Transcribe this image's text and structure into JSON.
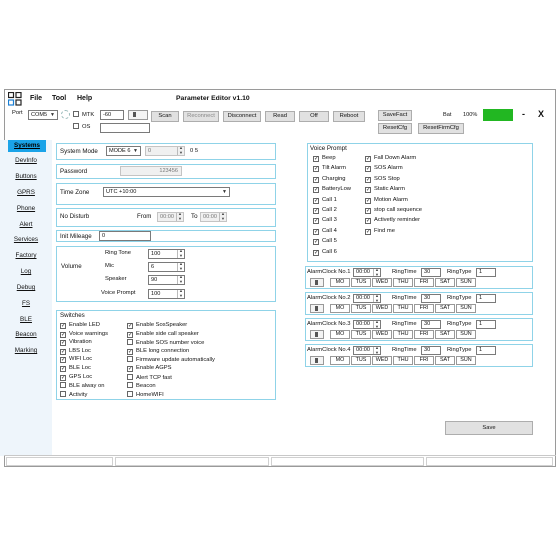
{
  "app": {
    "title": "Parameter Editor v1.10",
    "menu": [
      "File",
      "Tool",
      "Help"
    ],
    "close_label": "X",
    "minimize_label": "-"
  },
  "toolbar": {
    "port_label": "Port",
    "port_value": "COM5",
    "mtk_label": "MTK",
    "os_label": "OS",
    "level_value": "-60",
    "scan": "Scan",
    "reconnect": "Reconnect",
    "disconnect": "Disconnect",
    "read": "Read",
    "off": "Off",
    "reboot": "Reboot",
    "savefact": "SaveFact",
    "resetcfg": "ResetCfg",
    "resetfirmcfg": "ResetFirmCfg",
    "bat_label": "Bat",
    "bat_value": "100%",
    "bat_color": "#22b722"
  },
  "sidebar": {
    "items": [
      "Systems",
      "DevInfo",
      "Buttons",
      "GPRS",
      "Phone",
      "Alert",
      "Services",
      "Factory",
      "Log",
      "Debug",
      "FS",
      "BLE",
      "Beacon",
      "Marking"
    ],
    "active": "Systems",
    "active_color": "#1aa3e8"
  },
  "system": {
    "mode_label": "System Mode",
    "mode_value": "MODE 6",
    "mode_num": "0",
    "mode_extra": "0 5",
    "password_label": "Password",
    "password_value": "123456",
    "timezone_label": "Time Zone",
    "timezone_value": "UTC +10:00",
    "nodisturb_label": "No Disturb",
    "from_label": "From",
    "from_value": "00:00",
    "to_label": "To",
    "to_value": "00:00",
    "mileage_label": "Init Mileage",
    "mileage_value": "0"
  },
  "volume": {
    "label": "Volume",
    "ringtone_label": "Ring Tone",
    "ringtone_value": "100",
    "mic_label": "Mic",
    "mic_value": "6",
    "speaker_label": "Speaker",
    "speaker_value": "90",
    "voiceprompt_label": "Voice Prompt",
    "voiceprompt_value": "100"
  },
  "switches": {
    "title": "Switches",
    "col1": [
      {
        "label": "Enable LED",
        "checked": true
      },
      {
        "label": "Voice warnings",
        "checked": true
      },
      {
        "label": "Vibration",
        "checked": true
      },
      {
        "label": "LBS Loc",
        "checked": true
      },
      {
        "label": "WIFI Loc",
        "checked": true
      },
      {
        "label": "BLE Loc",
        "checked": true
      },
      {
        "label": "GPS Loc",
        "checked": true
      },
      {
        "label": "BLE alway on",
        "checked": false
      },
      {
        "label": "Activity",
        "checked": false
      }
    ],
    "col2": [
      {
        "label": "Enable SosSpeaker",
        "checked": true
      },
      {
        "label": "Enable side call speaker",
        "checked": true
      },
      {
        "label": "Enable SOS number voice",
        "checked": false
      },
      {
        "label": "BLE long connection",
        "checked": true
      },
      {
        "label": "Firmware update automatically",
        "checked": false
      },
      {
        "label": "Enable AGPS",
        "checked": true
      },
      {
        "label": "Alert TCP fast",
        "checked": false
      },
      {
        "label": "Beacon",
        "checked": false
      },
      {
        "label": "HomeWIFI",
        "checked": false
      }
    ]
  },
  "voice_prompt": {
    "title": "Voice Prompt",
    "col1": [
      {
        "label": "Beep",
        "checked": true
      },
      {
        "label": "Tilt Alarm",
        "checked": true
      },
      {
        "label": "Charging",
        "checked": true
      },
      {
        "label": "BatteryLow",
        "checked": true
      },
      {
        "label": "Call 1",
        "checked": true
      },
      {
        "label": "Call 2",
        "checked": true
      },
      {
        "label": "Call 3",
        "checked": true
      },
      {
        "label": "Call 4",
        "checked": true
      },
      {
        "label": "Call 5",
        "checked": true
      },
      {
        "label": "Call 6",
        "checked": true
      }
    ],
    "col2": [
      {
        "label": "Fall Down Alarm",
        "checked": true
      },
      {
        "label": "SOS Alarm",
        "checked": true
      },
      {
        "label": "SOS Stop",
        "checked": true
      },
      {
        "label": "Static Alarm",
        "checked": true
      },
      {
        "label": "Motion Alarm",
        "checked": true
      },
      {
        "label": "stop call sequence",
        "checked": true
      },
      {
        "label": "Activetly reminder",
        "checked": true
      },
      {
        "label": "Find me",
        "checked": true
      }
    ]
  },
  "alarms": [
    {
      "label": "AlarmClock No.1",
      "time": "00:00",
      "ringtime_label": "RingTime",
      "ringtime": "30",
      "ringtype_label": "RingType",
      "ringtype": "1"
    },
    {
      "label": "AlarmClock No.2",
      "time": "00:00",
      "ringtime_label": "RingTime",
      "ringtime": "30",
      "ringtype_label": "RingType",
      "ringtype": "1"
    },
    {
      "label": "AlarmClock No.3",
      "time": "00:00",
      "ringtime_label": "RingTime",
      "ringtime": "30",
      "ringtype_label": "RingType",
      "ringtype": "1"
    },
    {
      "label": "AlarmClock No.4",
      "time": "00:00",
      "ringtime_label": "RingTime",
      "ringtime": "30",
      "ringtype_label": "RingType",
      "ringtype": "1"
    }
  ],
  "days": [
    "MO",
    "TUS",
    "WED",
    "THU",
    "FRI",
    "SAT",
    "SUN"
  ],
  "save_label": "Save"
}
